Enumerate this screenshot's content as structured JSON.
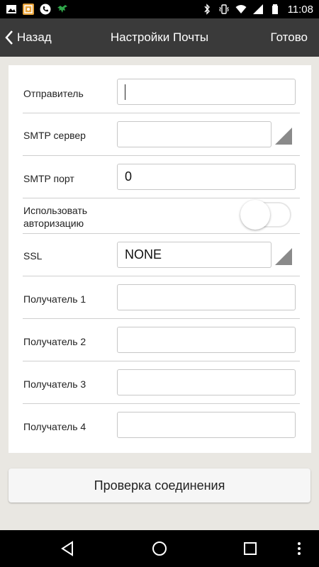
{
  "status_bar": {
    "time": "11:08",
    "icons": [
      "image-icon",
      "app-icon",
      "phone-icon",
      "eagle-icon",
      "bluetooth-icon",
      "vibrate-icon",
      "wifi-icon",
      "signal-icon",
      "battery-icon"
    ]
  },
  "header": {
    "back_label": "Назад",
    "title": "Настройки Почты",
    "done_label": "Готово"
  },
  "form": {
    "sender": {
      "label": "Отправитель",
      "value": ""
    },
    "smtp_server": {
      "label": "SMTP сервер",
      "value": ""
    },
    "smtp_port": {
      "label": "SMTP порт",
      "value": "0"
    },
    "use_auth": {
      "label": "Использовать авторизацию",
      "enabled": false
    },
    "ssl": {
      "label": "SSL",
      "value": "NONE"
    },
    "recipient1": {
      "label": "Получатель 1",
      "value": ""
    },
    "recipient2": {
      "label": "Получатель 2",
      "value": ""
    },
    "recipient3": {
      "label": "Получатель 3",
      "value": ""
    },
    "recipient4": {
      "label": "Получатель 4",
      "value": ""
    }
  },
  "test_button_label": "Проверка соединения",
  "colors": {
    "header_bg": "#3a3a3a",
    "page_bg": "#e9e7e2",
    "status_bg": "#000000",
    "nav_bg": "#000000"
  }
}
